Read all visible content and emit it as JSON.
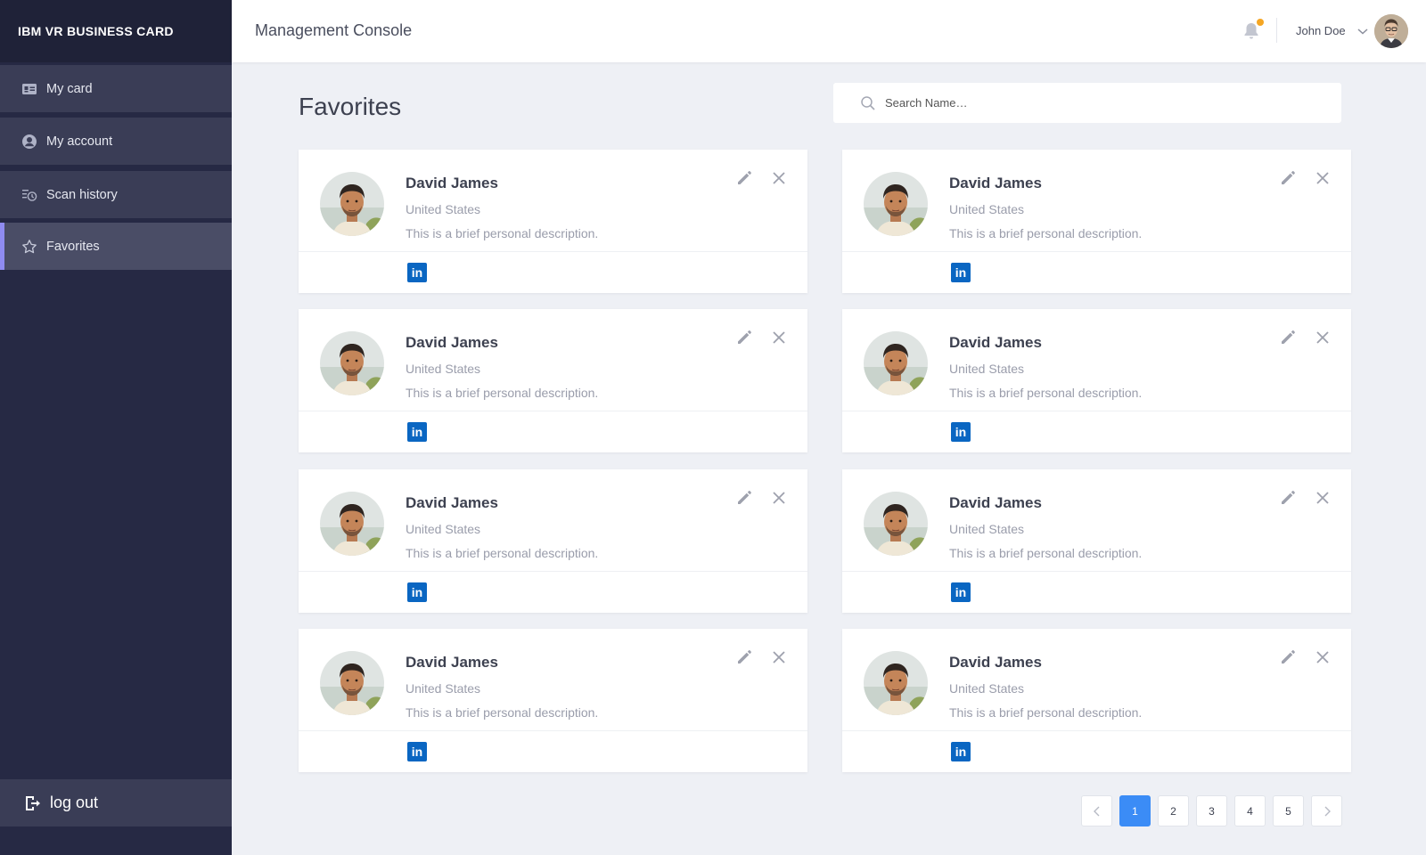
{
  "app": {
    "brand": "IBM VR BUSINESS CARD",
    "console_title": "Management Console"
  },
  "sidebar": {
    "items": [
      {
        "label": "My card",
        "icon": "id-card-icon"
      },
      {
        "label": "My account",
        "icon": "user-circle-icon"
      },
      {
        "label": "Scan history",
        "icon": "history-icon"
      },
      {
        "label": "Favorites",
        "icon": "star-icon",
        "active": true
      }
    ],
    "logout_label": "log out"
  },
  "header": {
    "user_name": "John Doe",
    "notification_dot_color": "#f5a623"
  },
  "main": {
    "title": "Favorites",
    "search": {
      "placeholder": "Search Name…"
    },
    "cards": [
      {
        "name": "David James",
        "country": "United States",
        "description": "This is a brief personal description.",
        "social": "in"
      },
      {
        "name": "David James",
        "country": "United States",
        "description": "This is a brief personal description.",
        "social": "in"
      },
      {
        "name": "David James",
        "country": "United States",
        "description": "This is a brief personal description.",
        "social": "in"
      },
      {
        "name": "David James",
        "country": "United States",
        "description": "This is a brief personal description.",
        "social": "in"
      },
      {
        "name": "David James",
        "country": "United States",
        "description": "This is a brief personal description.",
        "social": "in"
      },
      {
        "name": "David James",
        "country": "United States",
        "description": "This is a brief personal description.",
        "social": "in"
      },
      {
        "name": "David James",
        "country": "United States",
        "description": "This is a brief personal description.",
        "social": "in"
      },
      {
        "name": "David James",
        "country": "United States",
        "description": "This is a brief personal description.",
        "social": "in"
      }
    ]
  },
  "pagination": {
    "pages": [
      "1",
      "2",
      "3",
      "4",
      "5"
    ],
    "current": "1",
    "accent": "#3b8cf6"
  }
}
